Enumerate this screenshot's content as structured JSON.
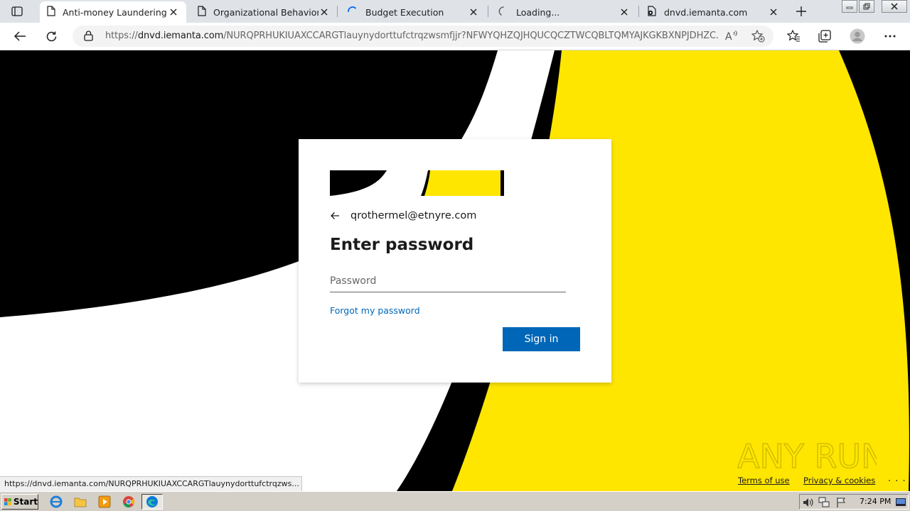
{
  "browser": {
    "tabs": [
      {
        "title": "Anti-money Laundering",
        "active": true,
        "icon": "document-icon"
      },
      {
        "title": "Organizational Behavior",
        "active": false,
        "icon": "document-icon"
      },
      {
        "title": "Budget Execution",
        "active": false,
        "icon": "loading-spinner-icon"
      },
      {
        "title": "Loading...",
        "active": false,
        "icon": "loading-spinner-icon"
      },
      {
        "title": "dnvd.iemanta.com",
        "active": false,
        "icon": "shared-document-icon"
      }
    ],
    "address": {
      "scheme": "https://",
      "host": "dnvd.iemanta.com",
      "path": "/NURQPRHUKIUAXCCARGTlauynydorttufctrqzwsmfjjr?NFWYQHZQJHQUCQCZTWCQBLTQMYAJKGKBXNPJDHZC..."
    }
  },
  "login": {
    "email": "qrothermel@etnyre.com",
    "heading": "Enter password",
    "password_placeholder": "Password",
    "password_value": "",
    "forgot_label": "Forgot my password",
    "signin_label": "Sign in"
  },
  "footer": {
    "terms": "Terms of use",
    "privacy": "Privacy & cookies",
    "more": ". . ."
  },
  "status_bar_url": "https://dnvd.iemanta.com/NURQPRHUKIUAXCCARGTlauynydorttufctrqzws...",
  "watermark": "ANY RUN",
  "taskbar": {
    "start_label": "Start",
    "clock": "7:24 PM"
  },
  "colors": {
    "accent_blue": "#0067b8",
    "brand_yellow": "#ffe600",
    "brand_black": "#000000"
  }
}
